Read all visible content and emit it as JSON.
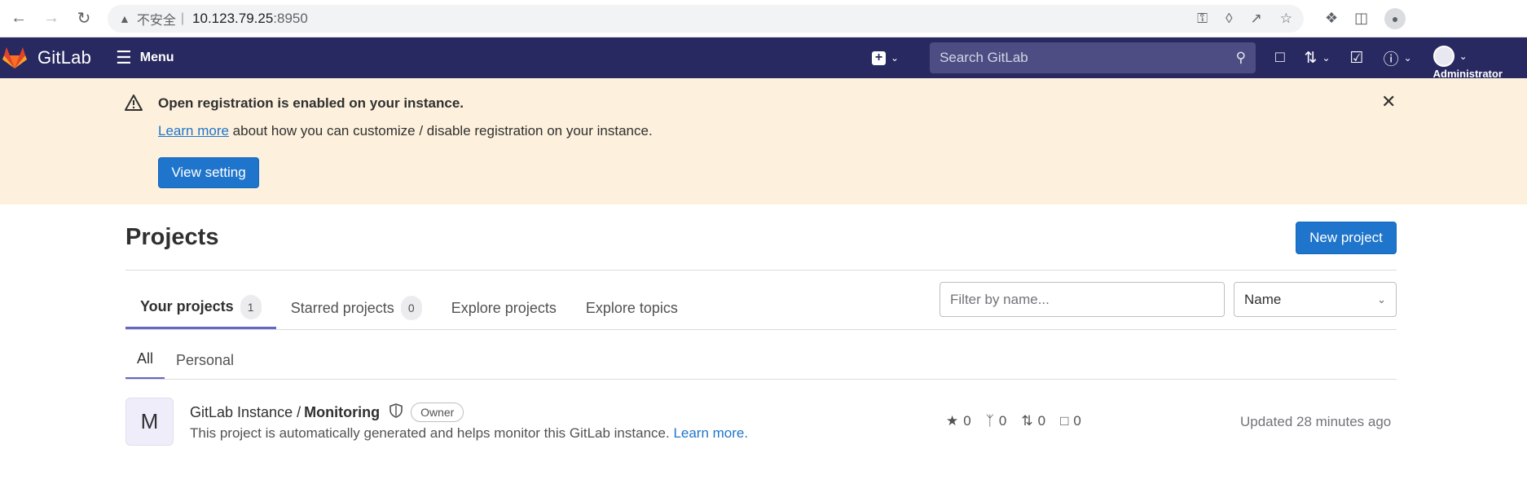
{
  "browser": {
    "insecure_label": "不安全",
    "separator": "|",
    "url_host": "10.123.79.25",
    "url_port": ":8950"
  },
  "navbar": {
    "brand": "GitLab",
    "menu_label": "Menu",
    "search_placeholder": "Search GitLab",
    "user_label": "Administrator",
    "colors": {
      "background": "#292961",
      "search_bg": "#4d4d84"
    }
  },
  "banner": {
    "title": "Open registration is enabled on your instance.",
    "link_text": "Learn more",
    "text_rest": " about how you can customize / disable registration on your instance.",
    "button_label": "View setting",
    "colors": {
      "background": "#fdf1dd",
      "accent": "#1f75cb"
    }
  },
  "page": {
    "title": "Projects",
    "new_project_label": "New project"
  },
  "tabs": [
    {
      "label": "Your projects",
      "count": "1",
      "active": true
    },
    {
      "label": "Starred projects",
      "count": "0",
      "active": false
    },
    {
      "label": "Explore projects",
      "active": false
    },
    {
      "label": "Explore topics",
      "active": false
    }
  ],
  "filter": {
    "placeholder": "Filter by name...",
    "sort_value": "Name"
  },
  "subtabs": [
    {
      "label": "All",
      "active": true
    },
    {
      "label": "Personal",
      "active": false
    }
  ],
  "projects": [
    {
      "avatar_letter": "M",
      "namespace": "GitLab Instance /",
      "name": "Monitoring",
      "role": "Owner",
      "description": "This project is automatically generated and helps monitor this GitLab instance.",
      "description_link": "Learn more.",
      "stars": "0",
      "forks": "0",
      "merge_requests": "0",
      "issues": "0",
      "updated": "Updated 28 minutes ago"
    }
  ]
}
